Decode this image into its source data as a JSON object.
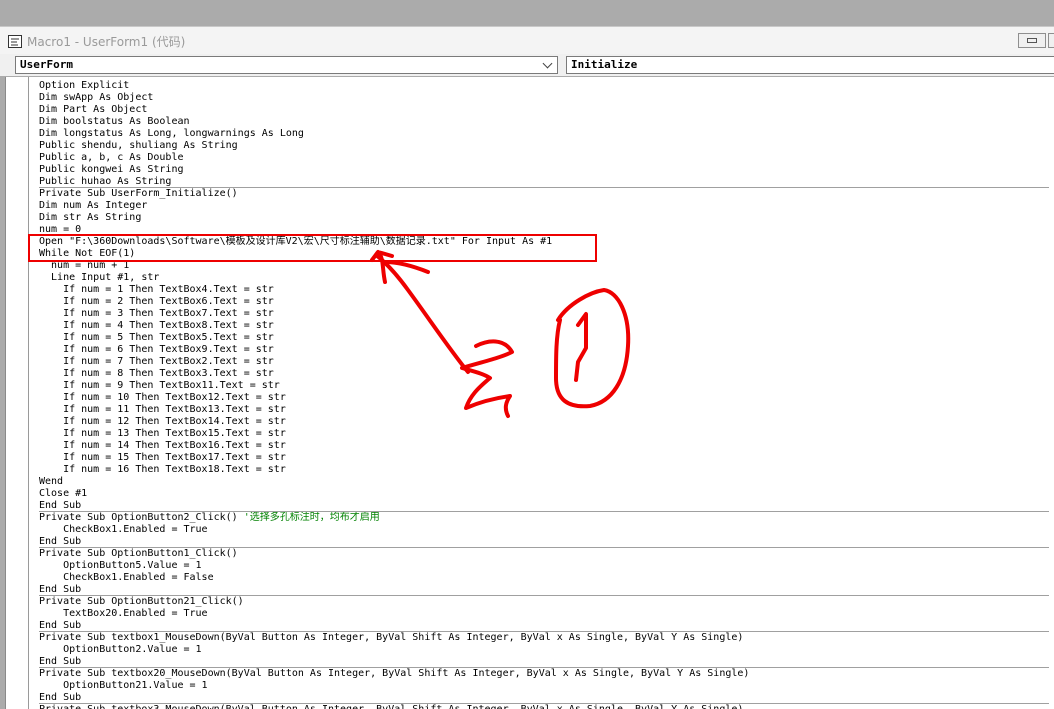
{
  "window": {
    "title": "Macro1 - UserForm1 (代码)"
  },
  "combos": {
    "object_value": "UserForm",
    "procedure_value": "Initialize"
  },
  "code_lines": [
    {
      "text": "Option Explicit"
    },
    {
      "text": "Dim swApp As Object"
    },
    {
      "text": "Dim Part As Object"
    },
    {
      "text": "Dim boolstatus As Boolean"
    },
    {
      "text": "Dim longstatus As Long, longwarnings As Long"
    },
    {
      "text": "Public shendu, shuliang As String"
    },
    {
      "text": "Public a, b, c As Double"
    },
    {
      "text": "Public kongwei As String"
    },
    {
      "text": "Public huhao As String",
      "sep": true
    },
    {
      "text": "Private Sub UserForm_Initialize()"
    },
    {
      "text": "Dim num As Integer"
    },
    {
      "text": "Dim str As String"
    },
    {
      "text": "num = 0"
    },
    {
      "text": "Open \"F:\\360Downloads\\Software\\模板及设计库V2\\宏\\尺寸标注辅助\\数据记录.txt\" For Input As #1"
    },
    {
      "text": "While Not EOF(1)"
    },
    {
      "text": "  num = num + 1"
    },
    {
      "text": "  Line Input #1, str"
    },
    {
      "text": "    If num = 1 Then TextBox4.Text = str"
    },
    {
      "text": "    If num = 2 Then TextBox6.Text = str"
    },
    {
      "text": "    If num = 3 Then TextBox7.Text = str"
    },
    {
      "text": "    If num = 4 Then TextBox8.Text = str"
    },
    {
      "text": "    If num = 5 Then TextBox5.Text = str"
    },
    {
      "text": "    If num = 6 Then TextBox9.Text = str"
    },
    {
      "text": "    If num = 7 Then TextBox2.Text = str"
    },
    {
      "text": "    If num = 8 Then TextBox3.Text = str"
    },
    {
      "text": "    If num = 9 Then TextBox11.Text = str"
    },
    {
      "text": "    If num = 10 Then TextBox12.Text = str"
    },
    {
      "text": "    If num = 11 Then TextBox13.Text = str"
    },
    {
      "text": "    If num = 12 Then TextBox14.Text = str"
    },
    {
      "text": "    If num = 13 Then TextBox15.Text = str"
    },
    {
      "text": "    If num = 14 Then TextBox16.Text = str"
    },
    {
      "text": "    If num = 15 Then TextBox17.Text = str"
    },
    {
      "text": "    If num = 16 Then TextBox18.Text = str"
    },
    {
      "text": "Wend"
    },
    {
      "text": "Close #1"
    },
    {
      "text": "End Sub",
      "sep": true
    },
    {
      "text": "Private Sub OptionButton2_Click() ",
      "comment": "'选择多孔标注时，均布才启用"
    },
    {
      "text": "    CheckBox1.Enabled = True"
    },
    {
      "text": "End Sub",
      "sep": true
    },
    {
      "text": "Private Sub OptionButton1_Click()"
    },
    {
      "text": "    OptionButton5.Value = 1"
    },
    {
      "text": "    CheckBox1.Enabled = False"
    },
    {
      "text": "End Sub",
      "sep": true
    },
    {
      "text": "Private Sub OptionButton21_Click()"
    },
    {
      "text": "    TextBox20.Enabled = True"
    },
    {
      "text": "End Sub",
      "sep": true
    },
    {
      "text": "Private Sub textbox1_MouseDown(ByVal Button As Integer, ByVal Shift As Integer, ByVal x As Single, ByVal Y As Single)"
    },
    {
      "text": "    OptionButton2.Value = 1"
    },
    {
      "text": "End Sub",
      "sep": true
    },
    {
      "text": "Private Sub textbox20_MouseDown(ByVal Button As Integer, ByVal Shift As Integer, ByVal x As Single, ByVal Y As Single)"
    },
    {
      "text": "    OptionButton21.Value = 1"
    },
    {
      "text": "End Sub",
      "sep": true
    },
    {
      "text": "Private Sub textbox3_MouseDown(ByVal Button As Integer, ByVal Shift As Integer, ByVal x As Single, ByVal Y As Single)"
    }
  ],
  "colors": {
    "annotation": "#ee0000",
    "comment": "#008000"
  }
}
